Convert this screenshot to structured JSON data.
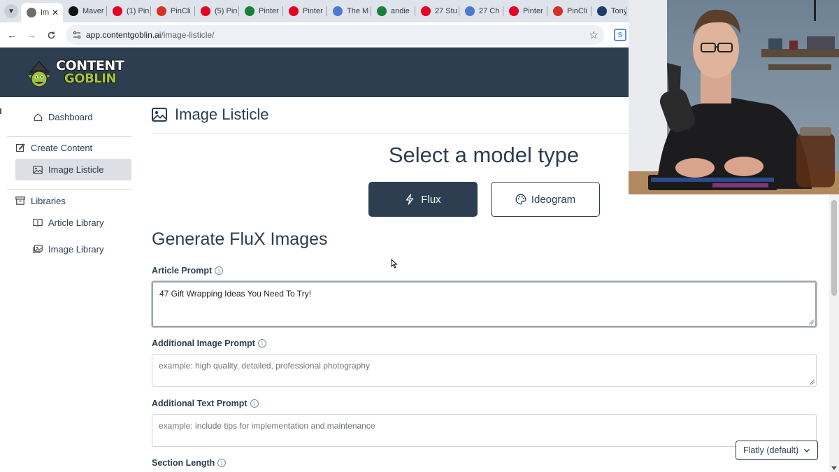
{
  "browser": {
    "tabs": [
      {
        "label": "Im",
        "color": "#6d6d6d",
        "active": true
      },
      {
        "label": "Maver",
        "color": "#111111"
      },
      {
        "label": "(1) Pin",
        "color": "#e60023"
      },
      {
        "label": "PinCli",
        "color": "#d93025"
      },
      {
        "label": "(5) Pin",
        "color": "#e60023"
      },
      {
        "label": "Pinter",
        "color": "#188038"
      },
      {
        "label": "Pinter",
        "color": "#e60023"
      },
      {
        "label": "The M",
        "color": "#4a7bd0"
      },
      {
        "label": "andie",
        "color": "#188038"
      },
      {
        "label": "27 Stu",
        "color": "#e60023"
      },
      {
        "label": "27 Ch",
        "color": "#4a7bd0"
      },
      {
        "label": "Pinter",
        "color": "#e60023"
      },
      {
        "label": "PinCli",
        "color": "#d93025"
      },
      {
        "label": "Tony",
        "color": "#1a3d6d"
      }
    ],
    "url_host": "app.contentgoblin.ai",
    "url_path": "/image-listicle/"
  },
  "brand": {
    "logo_line1": "CONTENT",
    "logo_line2": "GOBLIN",
    "header_color": "#2c3e50",
    "accent_green": "#a4c639"
  },
  "sidebar": {
    "dashboard": "Dashboard",
    "create_content": "Create Content",
    "image_listicle": "Image Listicle",
    "libraries": "Libraries",
    "article_library": "Article Library",
    "image_library": "Image Library"
  },
  "main": {
    "page_title": "Image Listicle",
    "model_heading": "Select a model type",
    "model_flux": "Flux",
    "model_ideogram": "Ideogram",
    "generate_heading": "Generate FluX Images",
    "article_prompt_label": "Article Prompt",
    "article_prompt_value": "47 Gift Wrapping Ideas You Need To Try!",
    "additional_image_label": "Additional Image Prompt",
    "additional_image_placeholder": "example: high quality, detailed, professional photography",
    "additional_text_label": "Additional Text Prompt",
    "additional_text_placeholder": "example: include tips for implementation and maintenance",
    "section_length_label": "Section Length",
    "info_glyph": "i"
  },
  "theme": {
    "selected": "Flatly (default)"
  }
}
